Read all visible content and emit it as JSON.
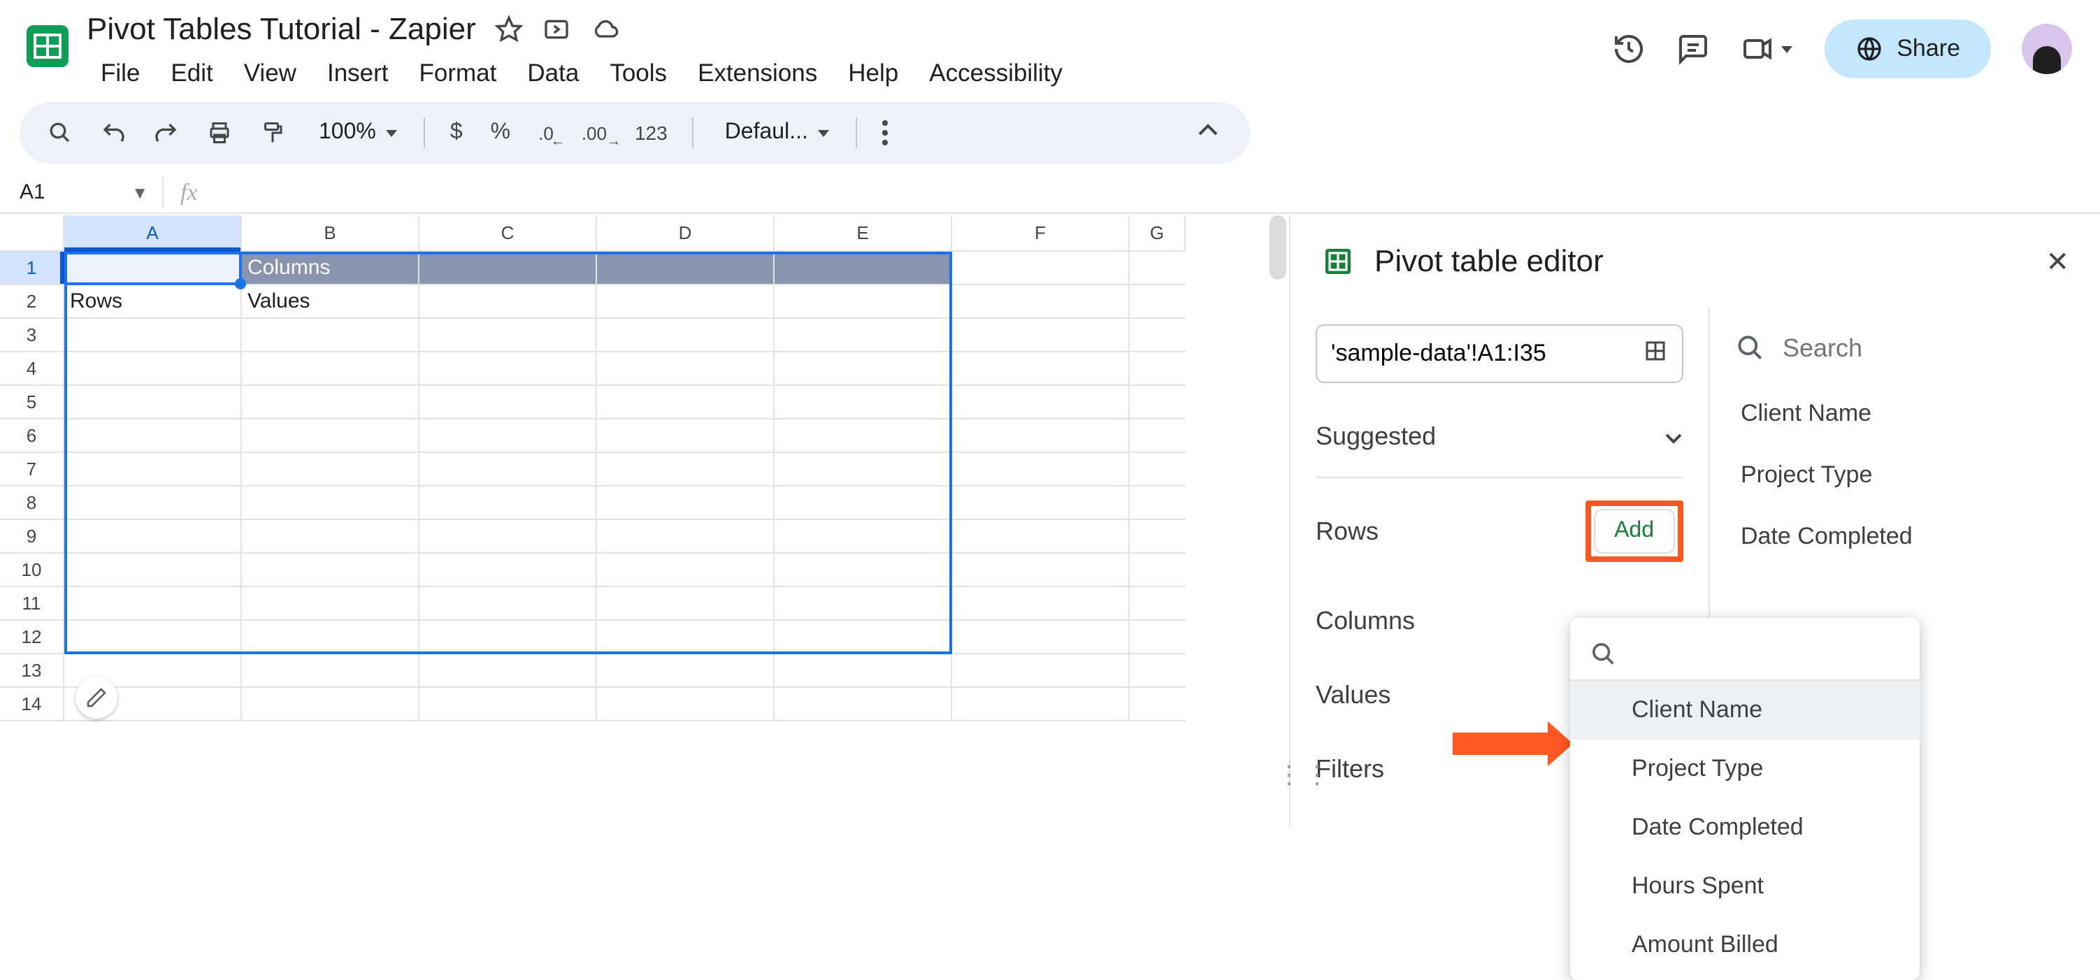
{
  "doc_title": "Pivot Tables Tutorial - Zapier",
  "menubar": [
    "File",
    "Edit",
    "View",
    "Insert",
    "Format",
    "Data",
    "Tools",
    "Extensions",
    "Help",
    "Accessibility"
  ],
  "share_label": "Share",
  "toolbar": {
    "zoom": "100%",
    "currency": "$",
    "percent": "%",
    "dec_dec": ".0",
    "inc_dec": ".00",
    "num123": "123",
    "font": "Defaul..."
  },
  "namebox": "A1",
  "columns": [
    "A",
    "B",
    "C",
    "D",
    "E",
    "F",
    "G"
  ],
  "row_count": 14,
  "cells": {
    "B1": "Columns",
    "A2": "Rows",
    "B2": "Values"
  },
  "panel": {
    "title": "Pivot table editor",
    "range": "'sample-data'!A1:I35",
    "suggested_label": "Suggested",
    "sections": {
      "rows": "Rows",
      "columns": "Columns",
      "values": "Values",
      "filters": "Filters"
    },
    "add_label": "Add",
    "search_placeholder": "Search",
    "fields": [
      "Client Name",
      "Project Type",
      "Date Completed"
    ],
    "popup_fields": [
      "Client Name",
      "Project Type",
      "Date Completed",
      "Hours Spent",
      "Amount Billed"
    ]
  }
}
